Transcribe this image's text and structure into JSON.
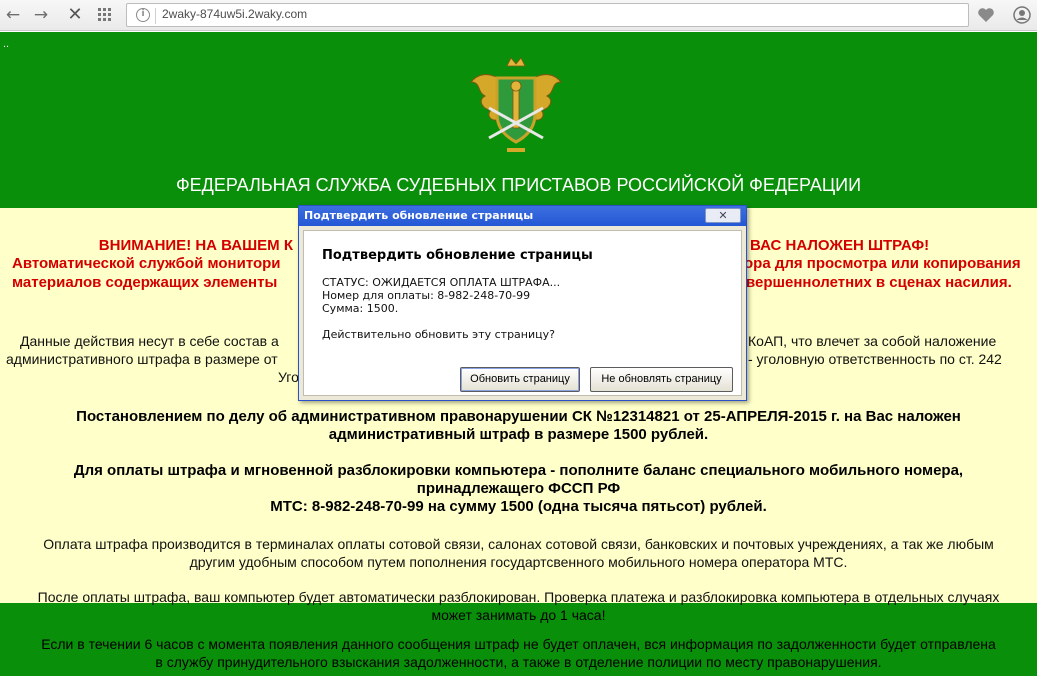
{
  "browser": {
    "url": "2waky-874uw5i.2waky.com"
  },
  "page": {
    "top_dots": "..",
    "title": "ФЕДЕРАЛЬНАЯ СЛУЖБА СУДЕБНЫХ ПРИСТАВОВ РОССИЙСКОЙ ФЕДЕРАЦИИ",
    "warning": [
      "ВНИМАНИЕ! НА ВАШЕМ К",
      "ВАС НАЛОЖЕН ШТРАФ!",
      "Автоматической службой монитори",
      "ора для просмотра или копирования",
      "материалов содержащих элементы",
      "вершеннолетних в сценах насилия."
    ],
    "para1": [
      "Данные действия несут в себе состав а",
      "КоАП, что влечет за собой наложение",
      "административного штрафа в размере от",
      "- уголовную ответственность по ст. 242",
      "Уго"
    ],
    "para2": [
      "Постановлением по делу об административном правонарушении СК №12314821 от 25-АПРЕЛЯ-2015 г. на Вас наложен",
      "административный штраф в размере 1500 рублей."
    ],
    "para3": [
      "Для оплаты штрафа и мгновенной разблокировки компьютера - пополните баланс специального мобильного номера,",
      "принадлежащего ФССП РФ",
      "МТС: 8-982-248-70-99 на сумму 1500 (одна тысяча пятьсот) рублей."
    ],
    "para4": [
      "Оплата штрафа производится в терминалах оплаты сотовой связи, салонах сотовой связи, банковских и почтовых учреждениях, а так же любым",
      "другим удобным способом путем пополнения государтсвенного мобильного номера оператора МТС."
    ],
    "para5": [
      "После оплаты штрафа, ваш компьютер будет автоматически разблокирован. Проверка платежа и разблокировка компьютера в отдельных случаях",
      "может занимать до 1 часа!"
    ],
    "para6": [
      "Если в течении 6 часов с момента появления данного сообщения штраф не будет оплачен, вся информация по задолженности будет отправлена",
      "в службу принудительного взыскания задолженности, а также в отделение полиции по месту правонарушения."
    ],
    "colors": {
      "green": "#0a8f0a",
      "cream": "#ffffc9",
      "red": "#d40000"
    }
  },
  "dialog": {
    "title": "Подтвердить обновление страницы",
    "close": "✕",
    "heading": "Подтвердить обновление страницы",
    "status": "СТАТУС: ОЖИДАЕТСЯ ОПЛАТА ШТРАФА...",
    "number": "Номер для оплаты: 8-982-248-70-99",
    "sum": "Сумма: 1500.",
    "question": "Действительно обновить эту страницу?",
    "btn_reload": "Обновить страницу",
    "btn_cancel": "Не обновлять страницу"
  }
}
